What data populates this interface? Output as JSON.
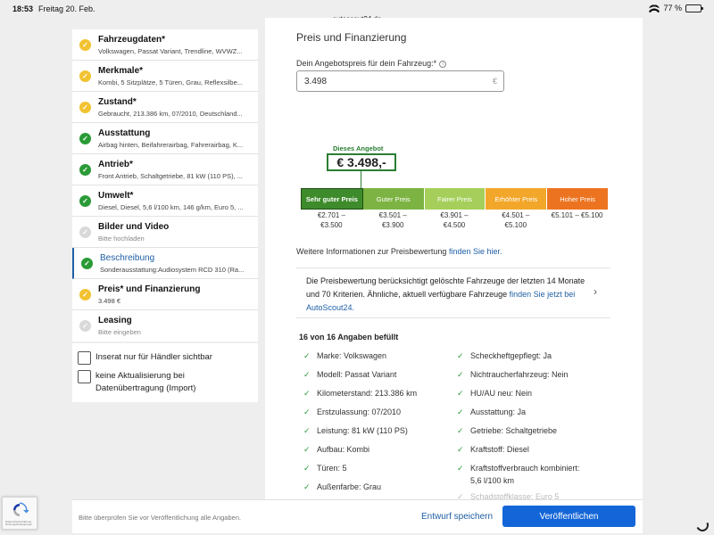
{
  "statusbar": {
    "time": "18:53",
    "date": "Freitag 20. Feb.",
    "url": "autoscout24.de",
    "battery": "77 %"
  },
  "colors": {
    "accent": "#1f5fa5",
    "button": "#1466d8",
    "ok": "#2a9b36",
    "warn": "#f2c230",
    "empty": "#d9d9d9"
  },
  "sidebar": {
    "steps": [
      {
        "title": "Fahrzeugdaten*",
        "sub": "Volkswagen, Passat Variant, Trendline, WVWZ...",
        "status": "warn"
      },
      {
        "title": "Merkmale*",
        "sub": "Kombi, 5 Sitzplätze, 5 Türen, Grau, Reflexsilbe...",
        "status": "warn"
      },
      {
        "title": "Zustand*",
        "sub": "Gebraucht, 213.386 km, 07/2010, Deutschland...",
        "status": "warn"
      },
      {
        "title": "Ausstattung",
        "sub": "Airbag hinten, Beifahrerairbag, Fahrerairbag, K...",
        "status": "ok"
      },
      {
        "title": "Antrieb*",
        "sub": "Front Antrieb, Schaltgetriebe, 81 kW (110 PS), ...",
        "status": "ok"
      },
      {
        "title": "Umwelt*",
        "sub": "Diesel, Diesel, 5,6 l/100 km, 146 g/km, Euro 5, ...",
        "status": "ok"
      },
      {
        "title": "Bilder und Video",
        "sub": "Bitte hochladen",
        "status": "empty"
      },
      {
        "title": "Beschreibung",
        "sub": "Sonderausstattung:Audiosystem RCD 310 (Ra...",
        "status": "ok"
      },
      {
        "title": "Preis* und Finanzierung",
        "sub": "3.498 €",
        "status": "warn"
      },
      {
        "title": "Leasing",
        "sub": "Bitte eingeben",
        "status": "empty"
      }
    ],
    "checkbox_dealer": "Inserat nur für Händler sichtbar",
    "checkbox_import": "keine Aktualisierung bei Datenübertragung (Import)"
  },
  "main": {
    "section_title": "Preis und Finanzierung",
    "offer_label": "Dein Angebotspreis für dein Fahrzeug:*",
    "info_icon": "i",
    "price_value": "3.498",
    "currency": "€",
    "badge_label": "Dieses Angebot",
    "badge_value": "€ 3.498,-",
    "rating": [
      {
        "label": "Sehr guter Preis",
        "range_from": "€2.701 –",
        "range_to": "€3.500",
        "color": "#3e8b2c"
      },
      {
        "label": "Guter Preis",
        "range_from": "€3.501 –",
        "range_to": "€3.900",
        "color": "#7cb342"
      },
      {
        "label": "Fairer Preis",
        "range_from": "€3.901 –",
        "range_to": "€4.500",
        "color": "#a5cf5a"
      },
      {
        "label": "Erhöhter Preis",
        "range_from": "€4.501 –",
        "range_to": "€5.100",
        "color": "#f2a72a"
      },
      {
        "label": "Hoher Preis",
        "range_from": "€5.101 – €5.100",
        "range_to": "",
        "color": "#ec7420"
      }
    ],
    "more_info_text": "Weitere Informationen zur Preisbewertung",
    "more_info_link": "finden Sie hier.",
    "note_text": "Die Preisbewertung berücksichtigt gelöschte Fahrzeuge der letzten 14 Monate und 70 Kriterien. Ähnliche, aktuell verfügbare Fahrzeuge",
    "note_link": "finden Sie jetzt bei AutoScout24.",
    "count_title": "16 von 16 Angaben befüllt",
    "facts_left": [
      "Marke: Volkswagen",
      "Modell: Passat Variant",
      "Kilometerstand: 213.386 km",
      "Erstzulassung: 07/2010",
      "Leistung: 81 kW (110 PS)",
      "Aufbau: Kombi",
      "Türen: 5",
      "Außenfarbe: Grau"
    ],
    "facts_right": [
      "Scheckheftgepflegt: Ja",
      "Nichtraucherfahrzeug: Nein",
      "HU/AU neu: Nein",
      "Ausstattung: Ja",
      "Getriebe: Schaltgetriebe",
      "Kraftstoff: Diesel",
      "Kraftstoffverbrauch kombiniert:",
      "5,6 l/100 km",
      "Schadstoffklasse: Euro 5"
    ]
  },
  "bottombar": {
    "hint": "Bitte überprüfen Sie vor Veröffentlichung alle Angaben.",
    "draft_label": "Entwurf speichern",
    "publish_label": "Veröffentlichen"
  },
  "recaptcha": {
    "text": "Datenschutzerklärung · Nutzungsbedingungen"
  }
}
